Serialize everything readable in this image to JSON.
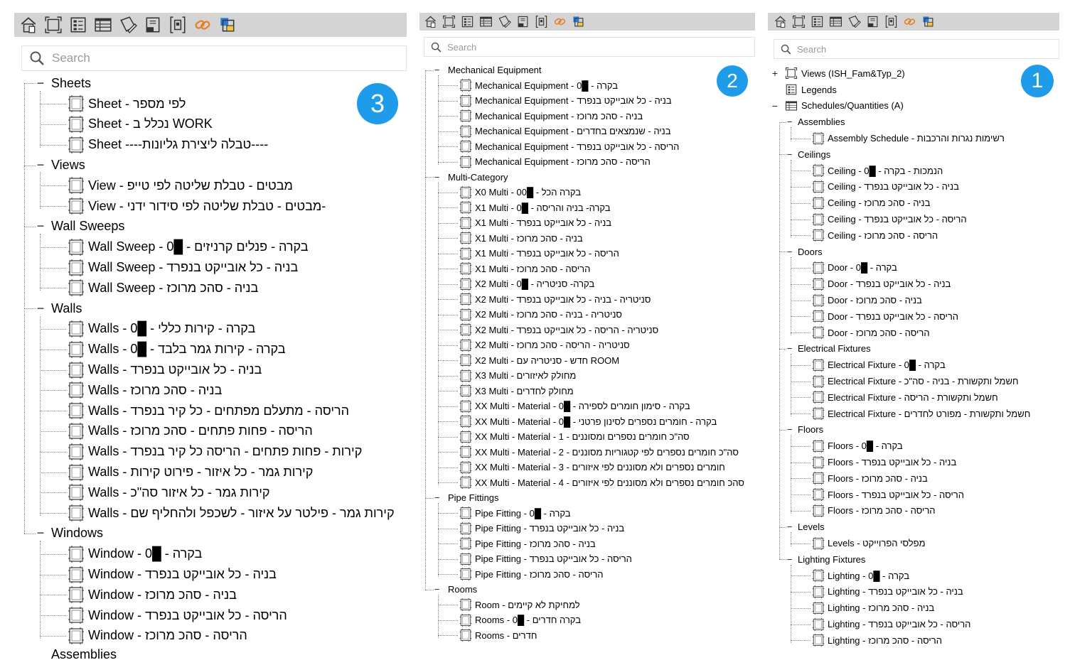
{
  "toolbar_icons": [
    "home-icon",
    "view-icon",
    "legend-icon",
    "schedule-icon",
    "sheet-pencil-icon",
    "sheet-icon",
    "group-icon",
    "link-icon",
    "family-icon"
  ],
  "search_placeholder": "Search",
  "panel3": {
    "badge": "3",
    "groups": [
      {
        "label": "Sheets",
        "items": [
          "Sheet - לפי מספר",
          "Sheet - נכלל ב WORK",
          "Sheet ----טבלה ליצירת גליונות----"
        ]
      },
      {
        "label": "Views",
        "items": [
          "View - מבטים - טבלת שליטה לפי טייפ",
          "View - מבטים - טבלת שליטה לפי סידור ידני-"
        ]
      },
      {
        "label": "Wall Sweeps",
        "items": [
          "Wall Sweep - 0█ - בקרה - פנלים קרניזים",
          "Wall Sweep - בניה - כל אובייקט בנפרד",
          "Wall Sweep - בניה - סהכ מרוכז"
        ]
      },
      {
        "label": "Walls",
        "items": [
          "Walls - 0█ - בקרה - קירות כללי",
          "Walls - 0█ - בקרה - קירות גמר בלבד",
          "Walls - בניה - כל אובייקט בנפרד",
          "Walls - בניה - סהכ מרוכז",
          "Walls - הריסה - מתעלם מפתחים - כל קיר בנפרד",
          "Walls - הריסה - פחות פתחים - סהכ מרוכז",
          "Walls - קירות - פחות פתחים - הריסה כל קיר בנפרד",
          "Walls - קירות גמר - כל איזור - פירוט קירות",
          "Walls - קירות גמר - כל איזור סה\"כ",
          "Walls - קירות גמר - פילטר על איזור - לשכפל ולהחליף שם"
        ]
      },
      {
        "label": "Windows",
        "items": [
          "Window - 0█ - בקרה",
          "Window - בניה - כל אובייקט בנפרד",
          "Window - בניה - סהכ מרוכז",
          "Window - הריסה - כל אובייקט בנפרד",
          "Window - הריסה - סהכ מרוכז"
        ]
      }
    ],
    "cut_label": "Assemblies"
  },
  "panel2": {
    "badge": "2",
    "groups": [
      {
        "label": "Mechanical Equipment",
        "items": [
          "Mechanical Equipment - 0█ - בקרה",
          "Mechanical Equipment - בניה - כל אובייקט בנפרד",
          "Mechanical Equipment - בניה - סהכ מרוכז",
          "Mechanical Equipment - בניה - שנמצאים בחדרים",
          "Mechanical Equipment - הריסה - כל אובייקט בנפרד",
          "Mechanical Equipment - הריסה - סהכ מרוכז"
        ]
      },
      {
        "label": "Multi-Category",
        "items": [
          "X0 Multi - 00█ - בקרה הכל",
          "X1 Multi - 0█ - בקרה- בניה והריסה",
          "X1 Multi - בניה - כל אובייקט בנפרד",
          "X1 Multi - בניה - סהכ מרוכז",
          "X1 Multi - הריסה - כל אובייקט בנפרד",
          "X1 Multi - הריסה - סהכ מרוכז",
          "X2 Multi - 0█ - בקרה- סניטריה",
          "X2 Multi - סניטריה - בניה - כל אובייקט בנפרד",
          "X2 Multi - סניטריה - בניה - סהכ מרוכז",
          "X2 Multi - סניטריה - הריסה - כל אובייקט בנפרד",
          "X2 Multi - סניטריה - הריסה - סהכ מרוכז",
          "X2 Multi - חדש - סניטריה עם ROOM",
          "X3 Multi - מחולק לאיזורים",
          "X3 Multi - מחולק לחדרים",
          "XX Multi - Material - 0█ - בקרה - סימון חומרים לספירה",
          "XX Multi - Material - 0█ - בקרה - חומרים נספרים לסינון פרטני",
          "XX Multi - Material - 1 - סה\"כ חומרים נספרים ומסוננים",
          "XX Multi - Material - 2 - סה\"כ חומרים נספרים לפי קטגוריות מסוננים",
          "XX Multi - Material - 3 - חומרים נספרים ולא מסוננים לפי איזורים",
          "XX Multi - Material - 4 - סהכ חומרים נספרים ולא מסוננים לפי איזורים"
        ]
      },
      {
        "label": "Pipe Fittings",
        "items": [
          "Pipe Fitting - 0█ - בקרה",
          "Pipe Fitting - בניה - כל אובייקט בנפרד",
          "Pipe Fitting - בניה - סהכ מרוכז",
          "Pipe Fitting - הריסה - כל אובייקט בנפרד",
          "Pipe Fitting - הריסה - סהכ מרוכז"
        ]
      },
      {
        "label": "Rooms",
        "items": [
          "Room - למחיקת לא קיימים",
          "Rooms - 0█ - בקרה חדרים",
          "Rooms - חדרים"
        ]
      }
    ]
  },
  "panel1": {
    "badge": "1",
    "top": [
      {
        "toggle": "+",
        "icon": "view",
        "label": "Views (ISH_Fam&Typ_2)"
      },
      {
        "toggle": "",
        "icon": "legend",
        "label": "Legends"
      },
      {
        "toggle": "−",
        "icon": "schedule",
        "label": "Schedules/Quantities (A)"
      }
    ],
    "groups": [
      {
        "label": "Assemblies",
        "items": [
          "Assembly Schedule - רשימות נגרות והרכבות"
        ]
      },
      {
        "label": "Ceilings",
        "items": [
          "Ceiling - 0█ - הנמכות - בקרה",
          "Ceiling - בניה - כל אובייקט בנפרד",
          "Ceiling - בניה - סהכ מרוכז",
          "Ceiling - הריסה - כל אובייקט בנפרד",
          "Ceiling - הריסה - סהכ מרוכז"
        ]
      },
      {
        "label": "Doors",
        "items": [
          "Door - 0█ - בקרה",
          "Door - בניה - כל אובייקט בנפרד",
          "Door - בניה - סהכ מרוכז",
          "Door - הריסה - כל אובייקט בנפרד",
          "Door - הריסה - סהכ מרוכז"
        ]
      },
      {
        "label": "Electrical Fixtures",
        "items": [
          "Electrical Fixture - 0█ - בקרה",
          "Electrical Fixture - חשמל ותקשורת - בניה - סה\"כ",
          "Electrical Fixture - חשמל ותקשורת - הריסה",
          "Electrical Fixture - חשמל ותקשורת - מפורט לחדרים"
        ]
      },
      {
        "label": "Floors",
        "items": [
          "Floors - 0█ - בקרה",
          "Floors - בניה - כל אובייקט בנפרד",
          "Floors - בניה - סהכ מרוכז",
          "Floors - הריסה - כל אובייקט בנפרד",
          "Floors - הריסה - סהכ מרוכז"
        ]
      },
      {
        "label": "Levels",
        "items": [
          "Levels - מפלסי הפרוייקט"
        ]
      },
      {
        "label": "Lighting Fixtures",
        "items": [
          "Lighting - 0█ - בקרה",
          "Lighting - בניה - כל אובייקט בנפרד",
          "Lighting - בניה - סהכ מרוכז",
          "Lighting - הריסה - כל אובייקט בנפרד",
          "Lighting - הריסה - סהכ מרוכז"
        ]
      }
    ]
  }
}
